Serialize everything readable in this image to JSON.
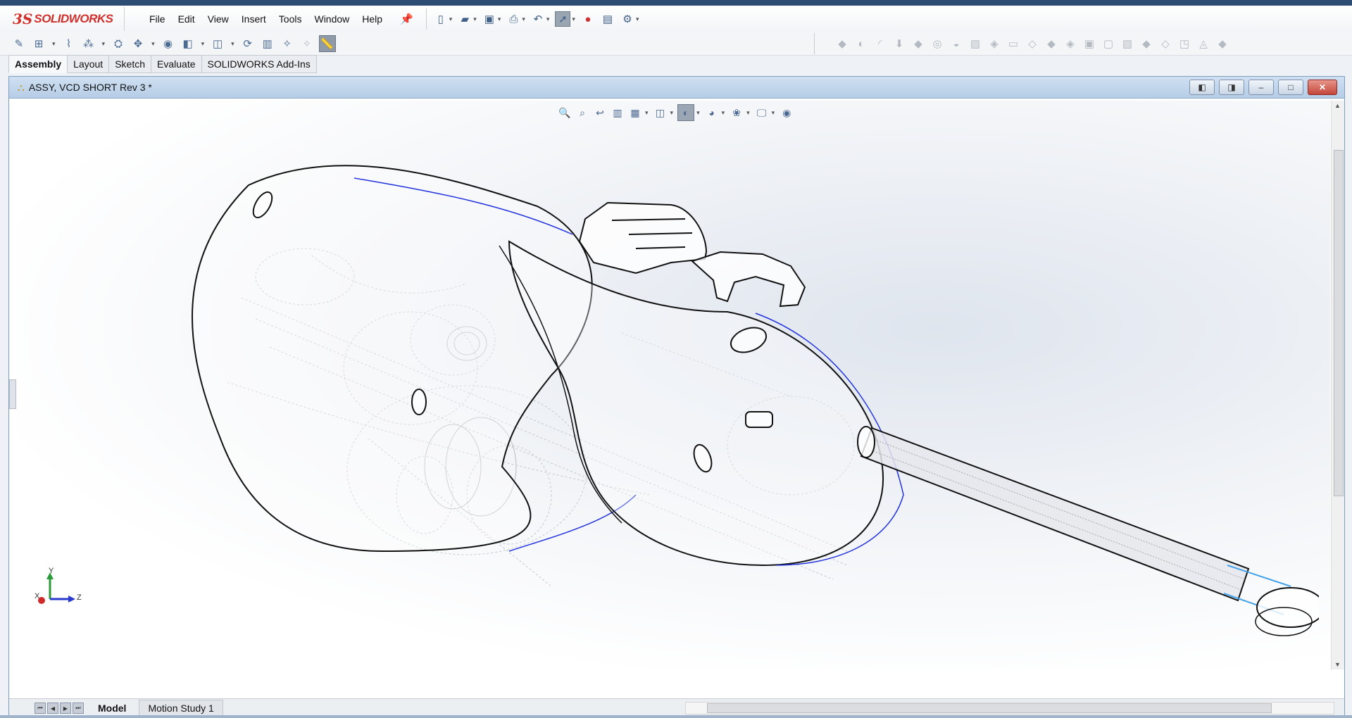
{
  "app": {
    "logo_mark": "3S",
    "logo_text": "SOLIDWORKS",
    "menu": [
      "File",
      "Edit",
      "View",
      "Insert",
      "Tools",
      "Window",
      "Help"
    ]
  },
  "tabs": [
    "Assembly",
    "Layout",
    "Sketch",
    "Evaluate",
    "SOLIDWORKS Add-Ins"
  ],
  "document": {
    "title": "ASSY, VCD SHORT Rev 3 *"
  },
  "triad": {
    "x": "X",
    "y": "Y",
    "z": "Z"
  },
  "bottom_tabs": {
    "model": "Model",
    "motion": "Motion Study 1"
  },
  "colors": {
    "brand_red": "#d0302b",
    "title_bar": "#c3d6ec",
    "edge_blue": "#2233dd"
  }
}
